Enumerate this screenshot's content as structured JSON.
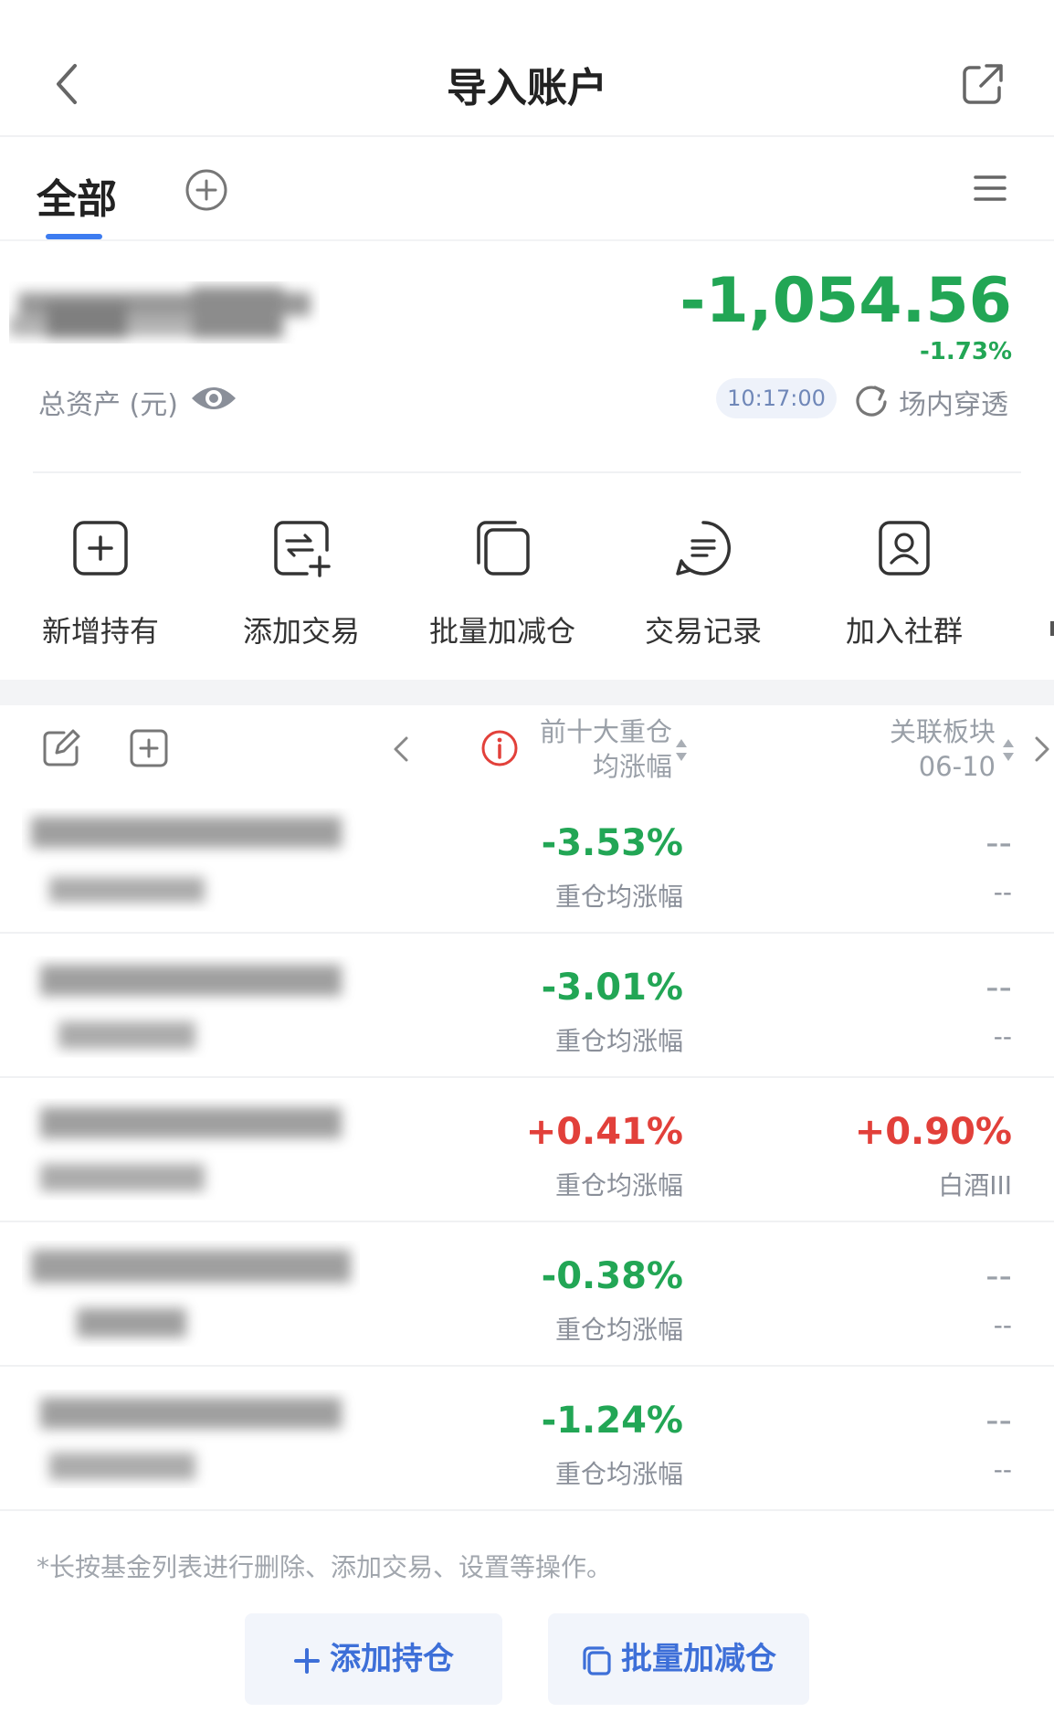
{
  "header": {
    "title": "导入账户",
    "back_icon": "chevron-left-icon",
    "share_icon": "external-link-icon"
  },
  "tabs": {
    "active_label": "全部",
    "add_icon": "plus-circle-icon",
    "menu_icon": "hamburger-menu-icon"
  },
  "summary": {
    "asset_label": "总资产 (元)",
    "asset_value_hidden": true,
    "pnl": "-1,054.56",
    "pnl_pct": "-1.73%",
    "time": "10:17:00",
    "refresh_label": "场内穿透"
  },
  "actions": [
    {
      "label": "新增持有",
      "icon": "add-square-icon"
    },
    {
      "label": "添加交易",
      "icon": "swap-add-icon"
    },
    {
      "label": "批量加减仓",
      "icon": "stack-copy-icon"
    },
    {
      "label": "交易记录",
      "icon": "list-record-icon"
    },
    {
      "label": "加入社群",
      "icon": "user-badge-icon"
    }
  ],
  "list_header": {
    "col1_line1": "前十大重仓",
    "col1_line2": "均涨幅",
    "col2_line1": "关联板块",
    "col2_line2": "06-10"
  },
  "rows": [
    {
      "v1": "-3.53%",
      "v1_color": "green",
      "s1": "重仓均涨幅",
      "v2": "--",
      "s2": "--"
    },
    {
      "v1": "-3.01%",
      "v1_color": "green",
      "s1": "重仓均涨幅",
      "v2": "--",
      "s2": "--"
    },
    {
      "v1": "+0.41%",
      "v1_color": "red",
      "s1": "重仓均涨幅",
      "v2": "+0.90%",
      "s2": "白酒III"
    },
    {
      "v1": "-0.38%",
      "v1_color": "green",
      "s1": "重仓均涨幅",
      "v2": "--",
      "s2": "--"
    },
    {
      "v1": "-1.24%",
      "v1_color": "green",
      "s1": "重仓均涨幅",
      "v2": "--",
      "s2": "--"
    }
  ],
  "hint": "*长按基金列表进行删除、添加交易、设置等操作。",
  "buttons": {
    "add_position": "添加持仓",
    "batch_adjust": "批量加减仓"
  },
  "colors": {
    "accent": "#3d7cf0",
    "down": "#22a655",
    "up": "#e2403a",
    "muted": "#8a8f99"
  }
}
